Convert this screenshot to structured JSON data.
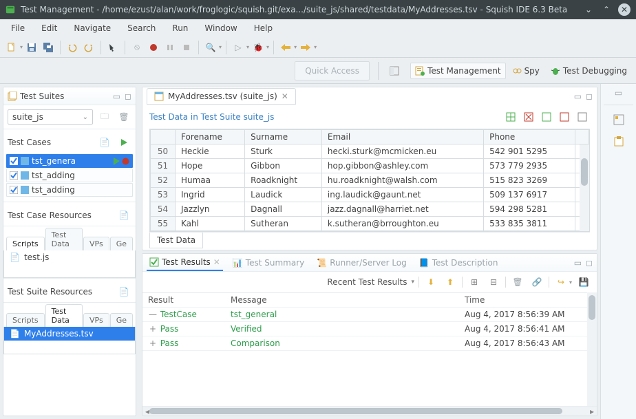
{
  "titlebar": {
    "text": "Test Management - /home/ezust/alan/work/froglogic/squish.git/exa.../suite_js/shared/testdata/MyAddresses.tsv - Squish IDE 6.3 Beta"
  },
  "menu": {
    "file": "File",
    "edit": "Edit",
    "navigate": "Navigate",
    "search": "Search",
    "run": "Run",
    "window": "Window",
    "help": "Help"
  },
  "quick_access": "Quick Access",
  "perspectives": {
    "test_mgmt": "Test Management",
    "spy": "Spy",
    "test_debugging": "Test Debugging"
  },
  "suites_view": {
    "title": "Test Suites",
    "combo": "suite_js",
    "test_cases_label": "Test Cases",
    "cases": [
      {
        "name": "tst_genera",
        "selected": true,
        "play": true
      },
      {
        "name": "tst_adding",
        "selected": false,
        "play": false
      },
      {
        "name": "tst_adding",
        "selected": false,
        "play": false
      }
    ],
    "tc_resources_label": "Test Case Resources",
    "tc_tabs": [
      "Scripts",
      "Test Data",
      "VPs",
      "Ge"
    ],
    "tc_file": "test.js",
    "ts_resources_label": "Test Suite Resources",
    "ts_tabs": [
      "Scripts",
      "Test Data",
      "VPs",
      "Ge"
    ],
    "ts_file": "MyAddresses.tsv"
  },
  "editor": {
    "tab_label": "MyAddresses.tsv (suite_js)",
    "title": "Test Data in Test Suite suite_js",
    "columns": {
      "rownum": "",
      "forename": "Forename",
      "surname": "Surname",
      "email": "Email",
      "phone": "Phone"
    },
    "rows": [
      {
        "n": "50",
        "f": "Heckie",
        "s": "Sturk",
        "e": "hecki.sturk@mcmicken.eu",
        "p": "542 901 5295"
      },
      {
        "n": "51",
        "f": "Hope",
        "s": "Gibbon",
        "e": "hop.gibbon@ashley.com",
        "p": "573 779 2935"
      },
      {
        "n": "52",
        "f": "Humaa",
        "s": "Roadknight",
        "e": "hu.roadknight@walsh.com",
        "p": "515 823 3269"
      },
      {
        "n": "53",
        "f": "Ingrid",
        "s": "Laudick",
        "e": "ing.laudick@gaunt.net",
        "p": "509 137 6917"
      },
      {
        "n": "54",
        "f": "Jazzlyn",
        "s": "Dagnall",
        "e": "jazz.dagnall@harriet.net",
        "p": "594 298 5281"
      },
      {
        "n": "55",
        "f": "Kahl",
        "s": "Sutheran",
        "e": "k.sutheran@brroughton.eu",
        "p": "533 835 3811"
      }
    ],
    "bottom_tab": "Test Data"
  },
  "results": {
    "tabs": {
      "results": "Test Results",
      "summary": "Test Summary",
      "runner": "Runner/Server Log",
      "desc": "Test Description"
    },
    "recent_label": "Recent Test Results",
    "columns": {
      "result": "Result",
      "message": "Message",
      "time": "Time"
    },
    "rows": [
      {
        "exp": "—",
        "result": "TestCase",
        "message": "tst_general",
        "time": "Aug 4, 2017 8:56:39 AM",
        "green": true
      },
      {
        "exp": "+",
        "result": "Pass",
        "message": "Verified",
        "time": "Aug 4, 2017 8:56:41 AM",
        "green": true
      },
      {
        "exp": "+",
        "result": "Pass",
        "message": "Comparison",
        "time": "Aug 4, 2017 8:56:43 AM",
        "green": true
      }
    ]
  }
}
